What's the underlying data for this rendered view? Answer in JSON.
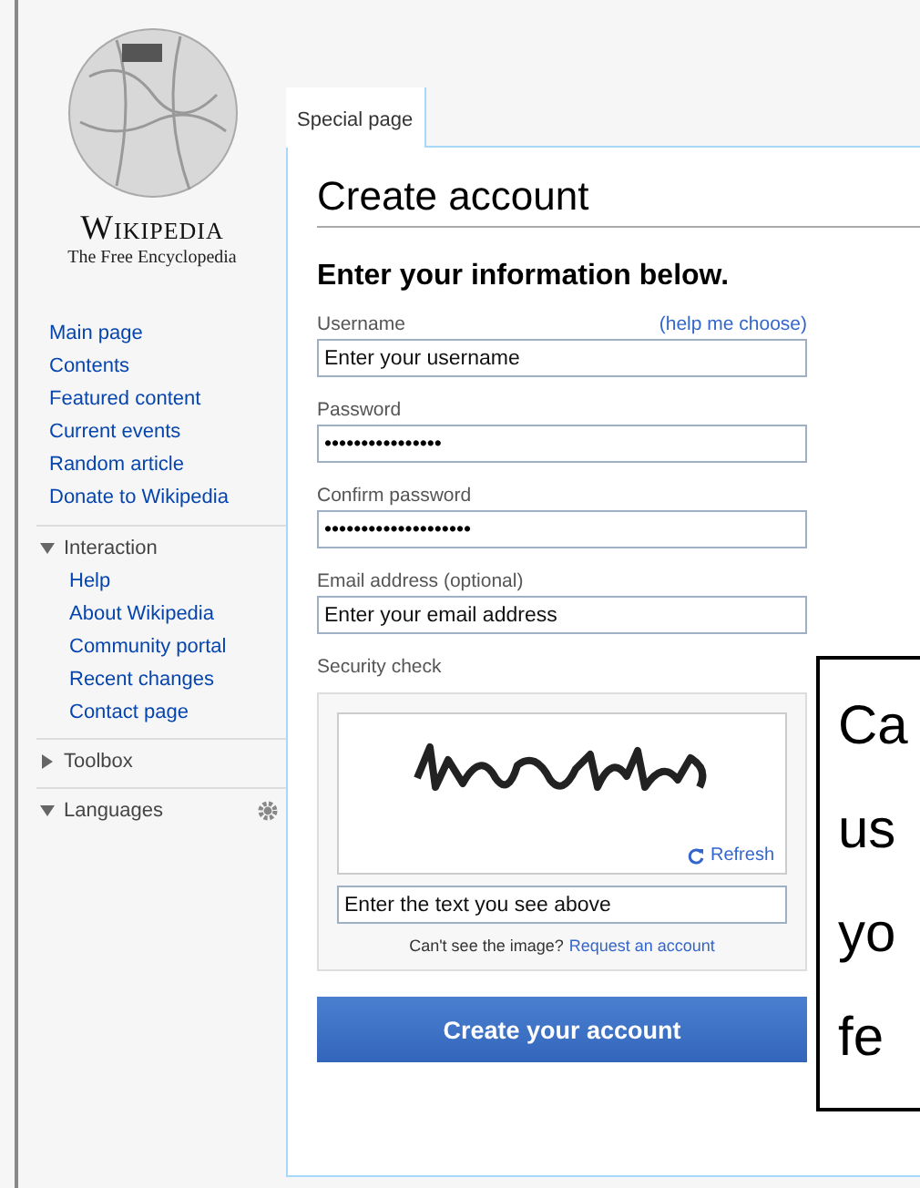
{
  "logo": {
    "wordmark": "Wikipedia",
    "tagline": "The Free Encyclopedia"
  },
  "navigation": [
    "Main page",
    "Contents",
    "Featured content",
    "Current events",
    "Random article",
    "Donate to Wikipedia"
  ],
  "portals": [
    {
      "title": "Interaction",
      "expanded": true,
      "items": [
        "Help",
        "About Wikipedia",
        "Community portal",
        "Recent changes",
        "Contact page"
      ],
      "settings": false
    },
    {
      "title": "Toolbox",
      "expanded": false,
      "settings": false
    },
    {
      "title": "Languages",
      "expanded": true,
      "settings": true
    }
  ],
  "tabs": [
    {
      "label": "Special page",
      "selected": true
    }
  ],
  "page_title": "Create account",
  "form": {
    "heading": "Enter your information below.",
    "fields": [
      {
        "label": "Username",
        "help_link": "(help me choose)",
        "placeholder": "Enter your username"
      },
      {
        "label": "Password",
        "value": "••••••••••••••••"
      },
      {
        "label": "Confirm password",
        "value": "••••••••••••••••••••"
      },
      {
        "label": "Email address (optional)",
        "placeholder": "Enter your email address"
      }
    ],
    "security": {
      "label": "Security check",
      "refresh": "Refresh",
      "placeholder": "Enter the text you see above",
      "note": "Can't see the image?",
      "link": "Request an account"
    },
    "submit": "Create your account"
  },
  "callout": {
    "lines": [
      "Ca",
      "us",
      "yo",
      "fe"
    ]
  }
}
